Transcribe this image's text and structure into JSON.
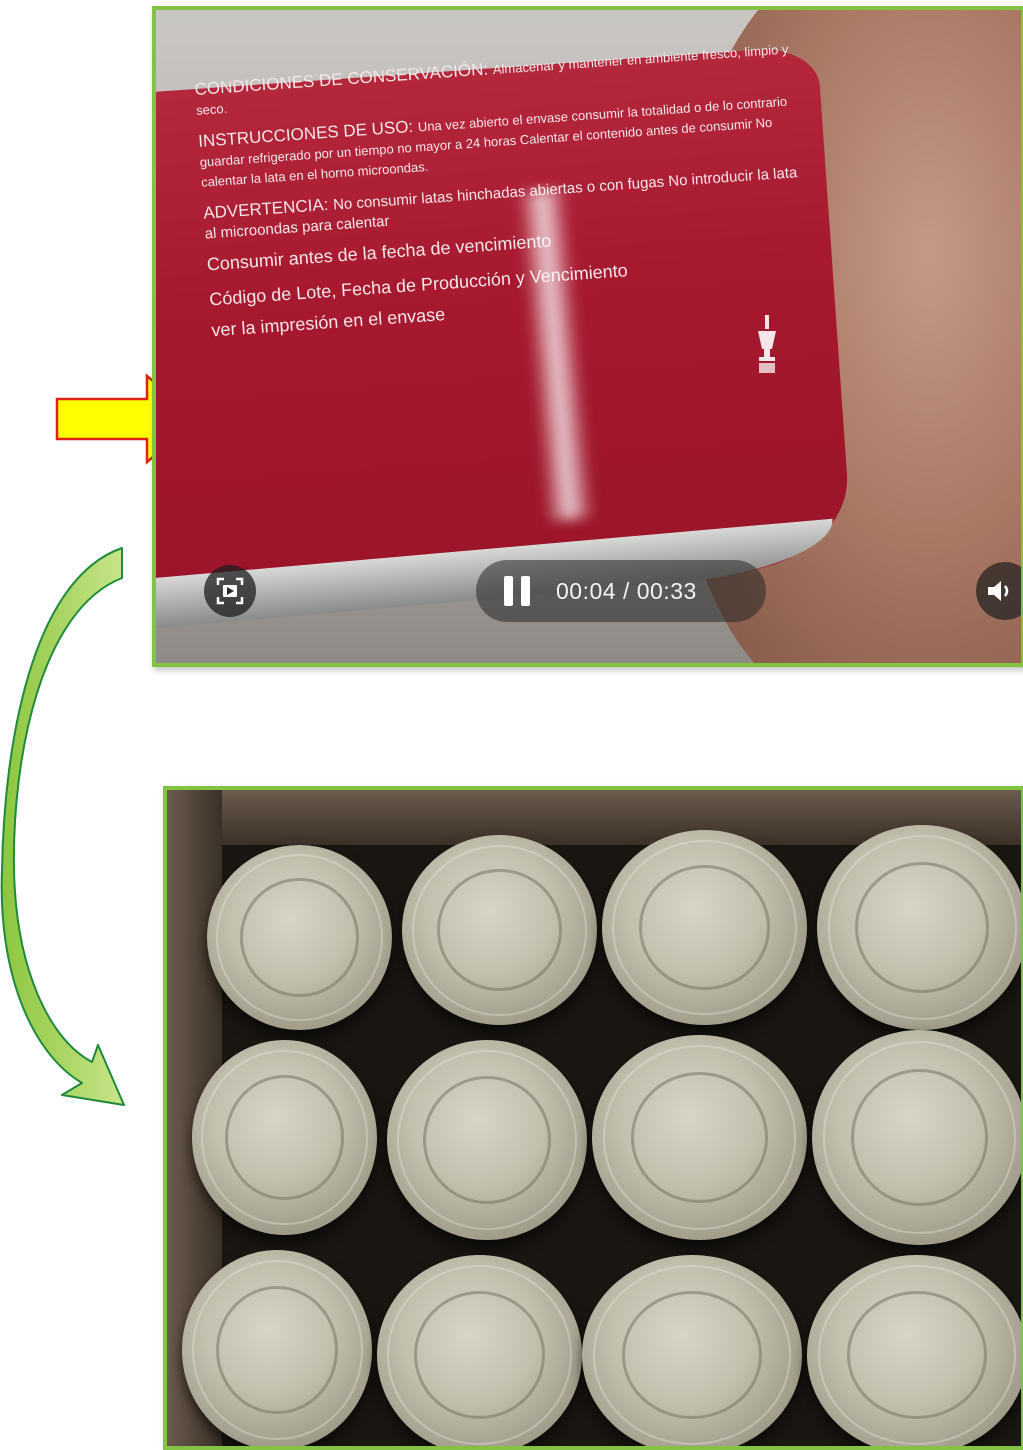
{
  "video_frame": {
    "label": {
      "conservacion_heading": "CONDICIONES DE CONSERVACIÓN:",
      "conservacion_text": "Almacenar y mantener en ambiente fresco, limpio y seco.",
      "uso_heading": "INSTRUCCIONES DE USO:",
      "uso_text": "Una vez abierto el envase consumir la totalidad o de lo contrario guardar refrigerado por un tiempo no mayor a 24 horas Calentar el contenido antes de consumir No calentar la lata en el horno microondas.",
      "advertencia_heading": "ADVERTENCIA:",
      "advertencia_text": "No consumir latas hinchadas abiertas o con fugas No introducir la lata al microondas para calentar",
      "fecha_text": "Consumir antes de la fecha de vencimiento",
      "lote_text": "Código de Lote, Fecha de Producción y Vencimiento",
      "impresion_text": "ver la impresión en el envase"
    },
    "player": {
      "state": "paused-icon-shown",
      "time_display": "00:04 / 00:33",
      "current_time": "00:04",
      "duration": "00:33"
    }
  },
  "colors": {
    "frame_border": "#82c341",
    "arrow_yellow_fill": "#ffff00",
    "arrow_yellow_stroke": "#e0201a",
    "arrow_green_light": "#8cc63f",
    "arrow_green_dark": "#1f8a3a",
    "can_label_red": "#a7192f"
  },
  "icons": {
    "screen_button": "picture-in-picture-icon",
    "pause": "pause-icon",
    "volume": "volume-icon",
    "label_symbol": "mortar-pestle-icon"
  }
}
